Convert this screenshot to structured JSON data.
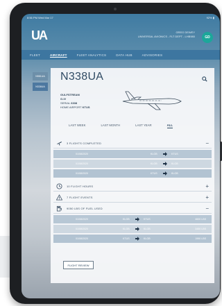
{
  "status_bar": {
    "time": "8:56 PM  Wed Mar 17",
    "battery": "92% ▮"
  },
  "header": {
    "logo": "UA",
    "user_name": "GREG DEWEY",
    "user_org": "UNIVERSAL AVIONICS - FLT DEPT - LHB980",
    "avatar": "GD"
  },
  "nav": {
    "tabs": [
      "FLEET",
      "AIRCRAFT",
      "FLEET ANALYTICS",
      "DATA HUB",
      "ADVISORIES"
    ],
    "active": "AIRCRAFT"
  },
  "side_tabs": [
    "N981UA",
    "N338UA"
  ],
  "aircraft": {
    "tail": "N338UA",
    "make": "GULFSTREAM",
    "model": "G-IV",
    "serial_label": "SERIAL",
    "serial_value": "6338",
    "home_label": "HOME AIRPORT",
    "home_value": "KTUS"
  },
  "time_tabs": [
    "LAST WEEK",
    "LAST MONTH",
    "LAST YEAR",
    "ALL"
  ],
  "time_tab_active": "ALL",
  "flights": {
    "label": "3 FLIGHTS COMPLETED",
    "toggle": "−",
    "rows": [
      {
        "date": "01/08/2020",
        "from": "KLGB",
        "to": "KTUS"
      },
      {
        "date": "01/08/2020",
        "from": "KLGB",
        "to": "KLGB"
      },
      {
        "date": "01/08/2020",
        "from": "KTUS",
        "to": "KLGB"
      }
    ]
  },
  "hours": {
    "label": "10 FLIGHT HOURS",
    "toggle": "+"
  },
  "events": {
    "label": "7 FLIGHT EVENTS",
    "toggle": "+"
  },
  "fuel": {
    "label": "9050 LBS OF FUEL USED",
    "toggle": "−",
    "rows": [
      {
        "date": "01/08/2020",
        "from": "KLGB",
        "to": "KTUS",
        "qty": "4600 LBS"
      },
      {
        "date": "01/08/2020",
        "from": "KLGB",
        "to": "KLGB",
        "qty": "3450 LBS"
      },
      {
        "date": "01/08/2020",
        "from": "KTUS",
        "to": "KLGB",
        "qty": "1990 LBS"
      }
    ]
  },
  "review_button": "FLIGHT REVIEW",
  "colors": {
    "brand": "#3d76a0",
    "avatar": "#1ca79a",
    "panel_text": "#2f4a63"
  }
}
